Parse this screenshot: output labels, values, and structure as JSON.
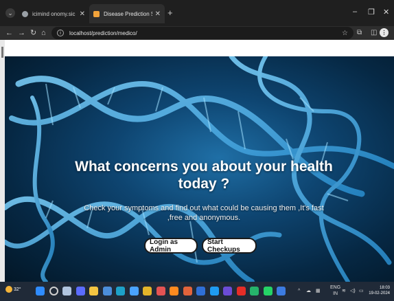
{
  "browser": {
    "tabs": [
      {
        "title": "icimind onomy.sic ir",
        "active": false,
        "favicon_color": "#9aa0a6"
      },
      {
        "title": "Disease Prediction System",
        "active": true,
        "favicon_color": "#f2a33a"
      }
    ],
    "url": "localhost/prediction/medico/",
    "icons": {
      "back": "back-arrow-icon",
      "forward": "forward-arrow-icon",
      "reload": "reload-icon",
      "home": "home-icon",
      "info": "site-info-icon",
      "bookmark": "star-icon",
      "extensions": "extensions-icon",
      "sidepanel": "side-panel-icon",
      "menu": "kebab-menu-icon"
    }
  },
  "hero": {
    "title": "What concerns you about your health today ?",
    "subtitle": "Check your symptoms and find out what could be causing them ,It's fast ,free and anonymous.",
    "buttons": {
      "admin": "Login as Admin",
      "checkup": "Start Checkups"
    }
  },
  "taskbar": {
    "weather": "32°",
    "lang_top": "ENG",
    "lang_bottom": "IN",
    "time": "18:03",
    "date": "19-02-2024",
    "apps": [
      {
        "name": "windows-start-icon",
        "color": "#2f8cff"
      },
      {
        "name": "search-icon",
        "color": "#d0d0d0"
      },
      {
        "name": "task-view-icon",
        "color": "#b0c4de"
      },
      {
        "name": "chat-icon",
        "color": "#5b6cff"
      },
      {
        "name": "file-explorer-icon",
        "color": "#f4c542"
      },
      {
        "name": "notes-icon",
        "color": "#4c8eda"
      },
      {
        "name": "edge-icon",
        "color": "#1da1c8"
      },
      {
        "name": "cortana-icon",
        "color": "#4aa3ff"
      },
      {
        "name": "chrome-icon",
        "color": "#e4b52a"
      },
      {
        "name": "shield-icon",
        "color": "#e55353"
      },
      {
        "name": "firefox-icon",
        "color": "#ff8a1f"
      },
      {
        "name": "office-icon",
        "color": "#e3643b"
      },
      {
        "name": "app-icon",
        "color": "#2f6fd6"
      },
      {
        "name": "vscode-icon",
        "color": "#1f9bf0"
      },
      {
        "name": "gallery-icon",
        "color": "#6b4cd6"
      },
      {
        "name": "youtube-icon",
        "color": "#e52d27"
      },
      {
        "name": "green-app-icon",
        "color": "#26b36b"
      },
      {
        "name": "whatsapp-icon",
        "color": "#25d366"
      },
      {
        "name": "store-icon",
        "color": "#3c7be0"
      }
    ]
  }
}
